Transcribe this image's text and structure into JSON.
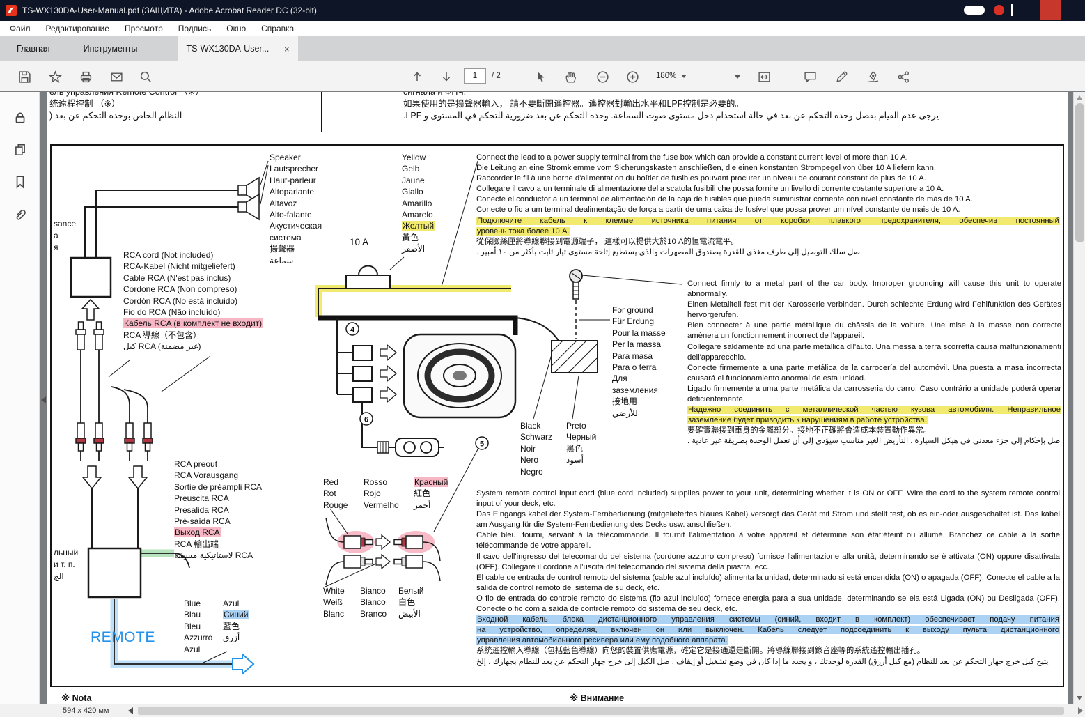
{
  "titlebar": {
    "title": "TS-WX130DA-User-Manual.pdf (ЗАЩИТА) - Adobe Acrobat Reader DC (32-bit)"
  },
  "menubar": {
    "items": [
      "Файл",
      "Редактирование",
      "Просмотр",
      "Подпись",
      "Окно",
      "Справка"
    ]
  },
  "tabs": {
    "home": "Главная",
    "tools": "Инструменты",
    "doc": "TS-WX130DA-User...",
    "close": "×"
  },
  "toolbar": {
    "page": "1",
    "page_total": "/ 2",
    "zoom": "180%"
  },
  "statusbar": {
    "page_size": "594 x 420 мм"
  },
  "colors": {
    "highlight_yellow": "#f1ea6e",
    "highlight_pink": "#f6b6c3",
    "highlight_blue": "#abd2f2",
    "highlight_green": "#b5e3bd",
    "remote_blue": "#2492ea",
    "wire_red": "#b03642"
  },
  "page": {
    "top_left_lines": [
      "ель управления Remote Control  （※）",
      "统遠程控制  （※）",
      {
        "t": "النظام الخاص بوحدة التحكم عن بعد (",
        "cls": "rtl"
      }
    ],
    "top_right_lines": [
      "сигнала и ФНЧ.",
      "如果使用的是揚聲器輸入， 請不要斷開遙控器。遙控器對輸出水平和LPF控制是必要的。",
      {
        "t": "يرجى عدم القيام بفصل وحدة التحكم عن بعد في حالة استخدام دخل مستوى صوت السماعة.  وحدة التحكم عن بعد ضرورية للتحكم في المستوى و LPF.",
        "cls": "rtl"
      }
    ],
    "note_left": "※ Nota",
    "note_right": "※ Внимание",
    "diagram": {
      "fuse_label": "10 A",
      "remote_label": "REMOTE",
      "num_harness": "4",
      "num_rca": "5",
      "num_fuseholder": "6",
      "left_fragments_top": [
        "sance",
        "а",
        "я"
      ],
      "left_fragments_bottom": [
        "льный",
        "и т. п.",
        "الج"
      ],
      "speaker_labels": [
        "Speaker",
        "Lautsprecher",
        "Haut-parleur",
        "Altoparlante",
        "Altavoz",
        "Alto-falante",
        "Акустическая",
        "система",
        "揚聲器",
        "سماعة"
      ],
      "yellow_labels": [
        "Yellow",
        "Gelb",
        "Jaune",
        "Giallo",
        "Amarillo",
        "Amarelo",
        {
          "t": "Желтый",
          "cls": "hl-y"
        },
        "黃色",
        "الأصفر"
      ],
      "rca_cord_labels": [
        "RCA cord (Not included)",
        "RCA-Kabel (Nicht mitgeliefert)",
        "Cable RCA (N'est pas inclus)",
        "Cordone RCA (Non compreso)",
        "Cordón RCA (No está incluido)",
        "Fio do RCA (Não incluído)",
        {
          "t": "Кабель RCA (в комплект не входит)",
          "cls": "hl-p"
        },
        "RCA 導線（不包含）",
        "كبل RCA (غير مضمنة)"
      ],
      "for_ground_labels": [
        "For ground",
        "Für Erdung",
        "Pour la masse",
        "Per la massa",
        "Para masa",
        "Para o terra",
        "Для",
        "заземления",
        "接地用",
        "للأرضي"
      ],
      "black_col1": [
        "Black",
        "Schwarz",
        "Noir",
        "Nero",
        "Negro"
      ],
      "black_col2": [
        "Preto",
        "Черный",
        "黑色",
        "أسود"
      ],
      "red_col1": [
        "Red",
        "Rot",
        "Rouge"
      ],
      "red_col2": [
        "Rosso",
        "Rojo",
        "Vermelho"
      ],
      "red_col3": [
        {
          "t": "Красный",
          "cls": "hl-p"
        },
        "紅色",
        "أحمر"
      ],
      "rca_preout_labels": [
        "RCA preout",
        "RCA Vorausgang",
        "Sortie de préampli RCA",
        "Preuscita RCA",
        "Presalida RCA",
        "Pré-saída RCA",
        {
          "t": "Выход  RCA",
          "cls": "hl-p"
        },
        "RCA 輸出端",
        "لاستاتيكية مسبقة RCA"
      ],
      "white_col1": [
        "White",
        "Weiß",
        "Blanc"
      ],
      "white_col2": [
        "Bianco",
        "Blanco",
        "Branco"
      ],
      "white_col3": [
        "Белый",
        "白色",
        "الأبيض"
      ],
      "blue_col1": [
        "Blue",
        "Blau",
        "Bleu",
        "Azzurro",
        "Azul"
      ],
      "blue_col2": [
        "Azul",
        {
          "t": "Синий",
          "cls": "hl-b"
        },
        "藍色",
        "أزرق"
      ],
      "power_lines": [
        "Connect the lead to a power supply terminal from the fuse box which can provide a constant current level of more than 10 A.",
        "Die Leitung an eine Stromklemme vom Sicherungskasten anschließen, die einen konstanten Strompegel von über 10 A liefern kann.",
        "Raccorder le fil à une borne d'alimentation du boîtier de fusibles pouvant procurer un niveau de courant constant de plus de 10 A.",
        "Collegare il cavo a un terminale di alimentazione della scatola fusibili che possa fornire un livello di corrente costante superiore a 10 A.",
        "Conecte el conductor a un terminal de alimentación de la caja de fusibles que pueda suministrar corriente con nivel constante de más de 10 A.",
        "Conecte o fio a um terminal dealimentação de força a partir de uma caixa de fusível que possa prover um nível constante de mais de 10 A.",
        {
          "t": "Подключите  кабель  к  клемме  источника  питания  от  коробки  плавкого  предохранителя,  обеспечив  постоянный",
          "cls": "hl-y j"
        },
        {
          "t": "уровень  тока  более  10  А.",
          "cls": "hl-y"
        },
        "從保險絲匣將導線聯接到電源端子，  這樣可以提供大於10 A的恒電流電平。",
        {
          "t": "صل سلك التوصيل إلى طرف مغذي للقدرة بصندوق المصهرات والذي يستطيع إتاحة مستوى تيار ثابت بأكثر من ١٠ أمبير .",
          "cls": "rtl"
        }
      ],
      "ground_lines": [
        "Connect firmly to a metal part of the car body.  Improper grounding will cause this unit to operate abnormally.",
        "Einen Metallteil fest mit der Karosserie verbinden. Durch schlechte Erdung wird Fehlfunktion des Gerätes hervorgerufen.",
        "Bien connecter à une partie métallique du châssis de la voiture. Une mise à la masse non correcte amènera un fonctionnement incorrect de l'appareil.",
        "Collegare saldamente ad una parte metallica dll'auto. Una messa a terra scorretta causa malfunzionamenti dell'apparecchio.",
        "Conecte firmemente a una parte metálica de la carrocería del automóvil. Una puesta a masa incorrecta causará el funcionamiento anormal de esta unidad.",
        "Ligado firmemente a uma parte metálica da carrosseria do carro. Caso contrário a unidade poderá operar deficientemente.",
        {
          "t": "Надежно  соединить  с  металлической  частью  кузова  автомобиля.  Неправильное",
          "cls": "hl-y j"
        },
        {
          "t": "заземление  будет  приводить  к  нарушениям  в  работе  устройства.",
          "cls": "hl-y"
        },
        "要確實聯接到車身的金屬部分。接地不正確將會造成本裝置動作異常。",
        {
          "t": "صل بإحكام إلى جزء معدني في هيكل السيارة . التأريض الغير مناسب سيؤدي إلى أن تعمل الوحدة بطريقة غير عادية .",
          "cls": "rtl"
        }
      ],
      "remote_lines": [
        "System remote control input cord (blue cord included) supplies power to your unit, determining whether it is ON or OFF. Wire the cord to the system remote control input of your deck, etc.",
        "Das Eingangs kabel der System-Fernbedienung (mitgeliefertes blaues Kabel) versorgt das Gerät mit Strom und stellt fest, ob es ein-oder ausgeschaltet ist.  Das kabel am Ausgang für die System-Fernbedienung  des  Decks usw. anschließen.",
        "Câble bleu, fourni, servant à la télécommande. Il fournit l'alimentation à votre appareil et détermine son état:éteint ou allumé. Branchez ce câble à la sortie télécommande de votre appareil.",
        "Il cavo dell'ingresso del telecomando del sistema (cordone azzurro compreso) fornisce l'alimentazione alla unità, determinando se è attivata (ON) oppure disattivata (OFF). Collegare il cordone all'uscita del  telecomando  del sistema della piastra. ecc.",
        "El cable de entrada de control remoto del sistema (cable azul incluído) alimenta la unidad, determinado si está encendida (ON) o apagada (OFF). Conecte el cable a la salida de control remoto del sistema de su deck, etc.",
        "O fio de entrada do controle remoto do sistema (fio azul incluído) fornece energia para a sua unidade, determinando se ela está Ligada (ON) ou Desligada (OFF). Conecte o fio com a saída de controle remoto do sistema de seu deck, etc.",
        {
          "t": "Входной  кабель  блока  дистанционного  управления  системы  (синий,  входит  в  комплект)  обеспечивает  подачу  питания",
          "cls": "hl-b j"
        },
        {
          "t": "на  устройство,  определяя,  включен  он  или  выключен.  Кабель  следует  подсоединить  к  выходу  пульта  дистанционного",
          "cls": "hl-b j"
        },
        {
          "t": "управления  автомобильного  ресивера  или  ему  подобного  аппарата.",
          "cls": "hl-b"
        },
        "系統遙控輸入導線（包括藍色導線）向您的裝置供應電源，確定它是接通還是斷開。將導線聯接到錄音座等的系統遙控輸出插孔。",
        {
          "t": "يتيح كبل خرج جهاز التحكم عن بعد للنظام (مع كبل أزرق) القدرة لوحدتك ، و يحدد ما إذا كان في وضع تشغيل أو إيقاف . صل الكبل إلى خرج جهاز التحكم عن بعد للنظام بجهازك ، إلخ",
          "cls": "rtl"
        }
      ]
    }
  }
}
